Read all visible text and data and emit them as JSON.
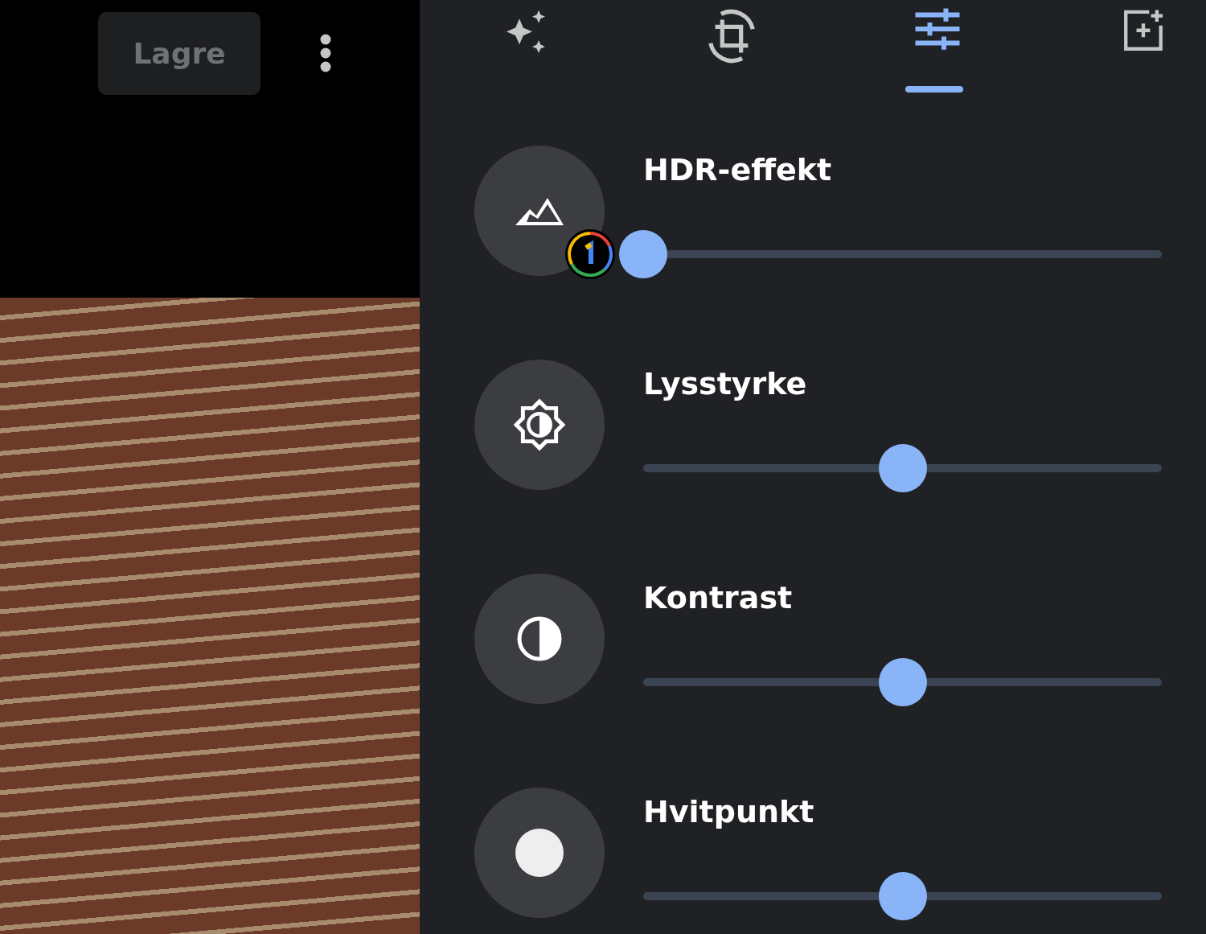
{
  "toolbar": {
    "save_button": "Lagre"
  },
  "tabs": [
    {
      "kind": "auto",
      "selected": false
    },
    {
      "kind": "crop",
      "selected": false
    },
    {
      "kind": "adjust",
      "selected": true
    },
    {
      "kind": "markup",
      "selected": false
    }
  ],
  "sliders": [
    {
      "kind": "hdr",
      "label": "HDR-effekt",
      "level": 0,
      "badge": true
    },
    {
      "kind": "brightness",
      "label": "Lysstyrke",
      "level": 0.5,
      "badge": false
    },
    {
      "kind": "contrast",
      "label": "Kontrast",
      "level": 0.5,
      "badge": false
    },
    {
      "kind": "whitepoint",
      "label": "Hvitpunkt",
      "level": 0.5,
      "badge": false
    }
  ]
}
